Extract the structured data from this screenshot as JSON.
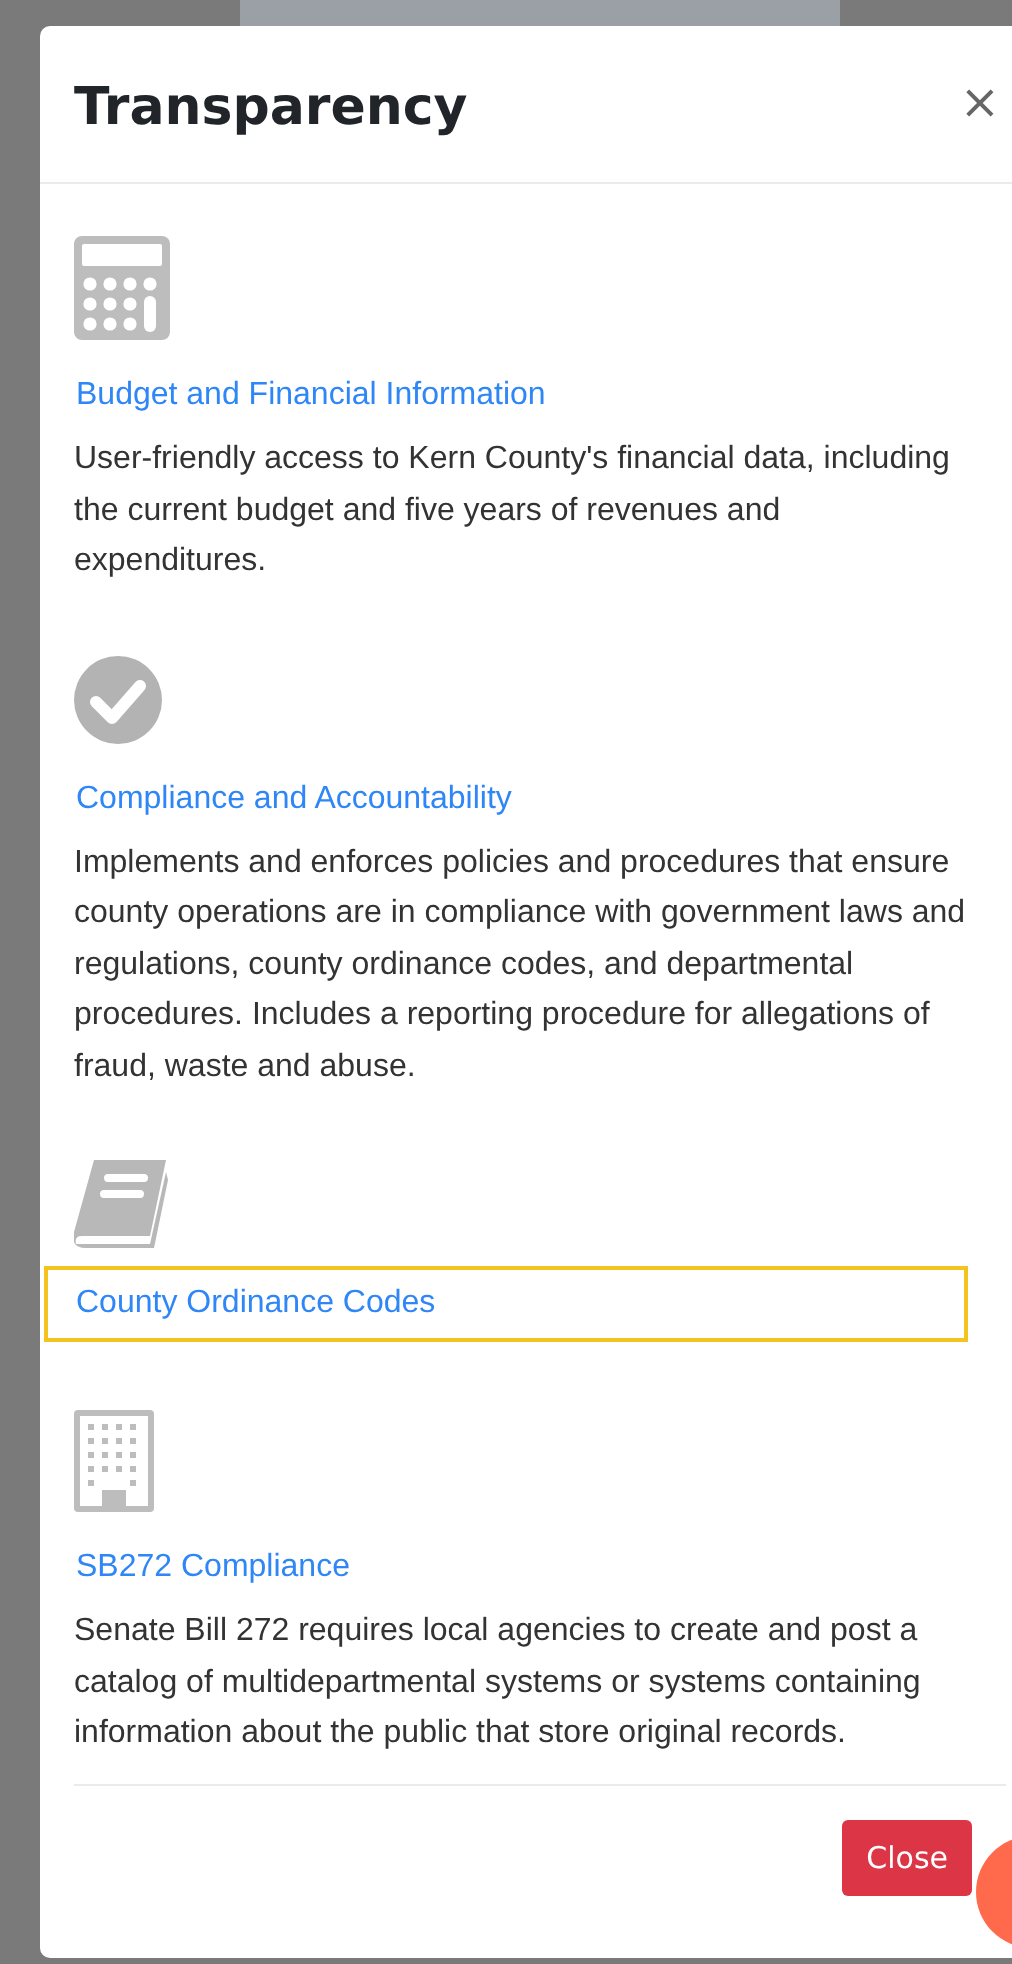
{
  "dialog": {
    "title": "Transparency",
    "close_icon": "×",
    "items": [
      {
        "kind": "calculator",
        "link": "Budget and Financial Information",
        "focused": false,
        "description": "User-friendly access to Kern County's financial data, including the current budget and five years of revenues and expenditures."
      },
      {
        "kind": "check",
        "link": "Compliance and Accountability",
        "focused": false,
        "description": "Implements and enforces policies and procedures that ensure county operations are in compliance with government laws and regulations, county ordinance codes, and departmental procedures. Includes a reporting procedure for allegations of fraud, waste and abuse."
      },
      {
        "kind": "book",
        "link": "County Ordinance Codes",
        "focused": true
      },
      {
        "kind": "building",
        "link": "SB272 Compliance",
        "focused": false,
        "description": "Senate Bill 272 requires local agencies to create and post a catalog of multidepartmental systems or systems containing information about the public that store original records."
      }
    ],
    "footer_button": "Close"
  }
}
